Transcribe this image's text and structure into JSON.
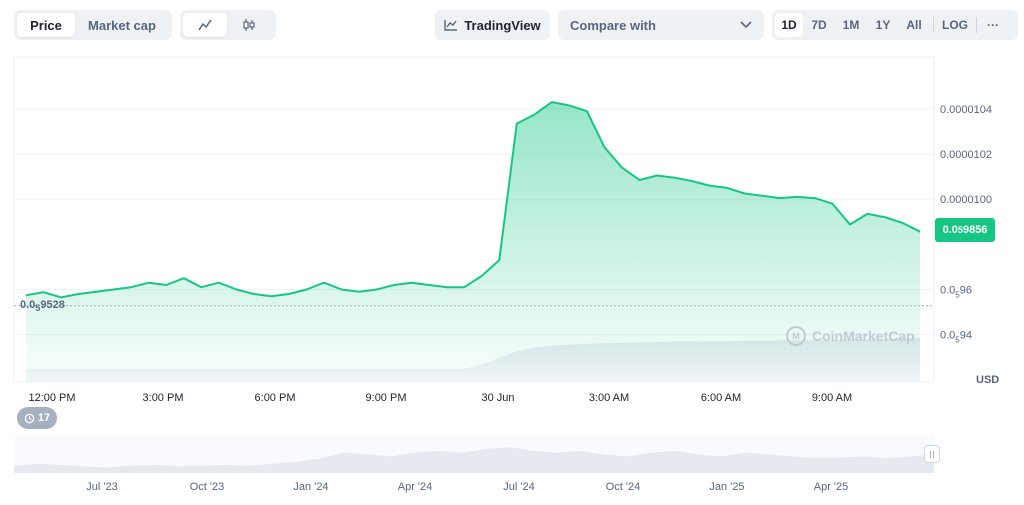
{
  "toolbar": {
    "view_tabs": [
      "Price",
      "Market cap"
    ],
    "active_view": "Price",
    "chart_types": [
      "line-chart-icon",
      "candlestick-icon"
    ],
    "tradingview_label": "TradingView",
    "compare_placeholder": "Compare with",
    "ranges": [
      "1D",
      "7D",
      "1M",
      "1Y",
      "All"
    ],
    "active_range": "1D",
    "log_label": "LOG",
    "more_label": "···"
  },
  "current_price": {
    "prefix": "0.0",
    "sub": "5",
    "digits": "9856"
  },
  "low_price": {
    "prefix": "0.0",
    "sub": "5",
    "digits": "9528"
  },
  "currency": "USD",
  "watermark": "CoinMarketCap",
  "events_count": "17",
  "colors": {
    "line": "#16c784",
    "fill_top": "#16c784",
    "navigator": "#e6eaf0",
    "grid": "#eff2f5"
  },
  "chart_data": {
    "type": "area",
    "x_tick_labels": [
      "12:00 PM",
      "3:00 PM",
      "6:00 PM",
      "9:00 PM",
      "30 Jun",
      "3:00 AM",
      "6:00 AM",
      "9:00 AM"
    ],
    "x": [
      "11:00 AM",
      "11:30 AM",
      "12:00 PM",
      "12:30 PM",
      "1:00 PM",
      "1:30 PM",
      "2:00 PM",
      "2:30 PM",
      "3:00 PM",
      "3:30 PM",
      "4:00 PM",
      "4:30 PM",
      "5:00 PM",
      "5:30 PM",
      "6:00 PM",
      "6:30 PM",
      "7:00 PM",
      "7:30 PM",
      "8:00 PM",
      "8:30 PM",
      "9:00 PM",
      "9:30 PM",
      "10:00 PM",
      "10:30 PM",
      "11:00 PM",
      "11:30 PM",
      "11:45 PM",
      "12:00 AM",
      "12:30 AM",
      "1:00 AM",
      "1:30 AM",
      "2:00 AM",
      "2:30 AM",
      "3:00 AM",
      "3:30 AM",
      "4:00 AM",
      "4:30 AM",
      "5:00 AM",
      "5:30 AM",
      "6:00 AM",
      "6:30 AM",
      "7:00 AM",
      "7:30 AM",
      "8:00 AM",
      "8:15 AM",
      "8:30 AM",
      "8:45 AM",
      "9:00 AM",
      "9:30 AM",
      "10:00 AM",
      "10:30 AM",
      "11:00 AM"
    ],
    "values": [
      9.574e-07,
      9.588e-07,
      9.565e-07,
      9.58e-07,
      9.59e-07,
      9.6e-07,
      9.61e-07,
      9.63e-07,
      9.62e-07,
      9.65e-07,
      9.61e-07,
      9.63e-07,
      9.6e-07,
      9.58e-07,
      9.57e-07,
      9.58e-07,
      9.6e-07,
      9.63e-07,
      9.6e-07,
      9.59e-07,
      9.6e-07,
      9.62e-07,
      9.63e-07,
      9.62e-07,
      9.61e-07,
      9.61e-07,
      9.66e-07,
      9.73e-07,
      1.0335e-06,
      1.0375e-06,
      1.043e-06,
      1.0415e-06,
      1.039e-06,
      1.023e-06,
      1.014e-06,
      1.0085e-06,
      1.0105e-06,
      1.0095e-06,
      1.008e-06,
      1.006e-06,
      1.005e-06,
      1.0025e-06,
      1.0015e-06,
      1.0005e-06,
      1.001e-06,
      1.0005e-06,
      9.98e-07,
      9.888e-07,
      9.935e-07,
      9.92e-07,
      9.895e-07,
      9.856e-07
    ],
    "volume": [
      0.3,
      0.3,
      0.3,
      0.3,
      0.3,
      0.3,
      0.3,
      0.3,
      0.3,
      0.3,
      0.3,
      0.3,
      0.3,
      0.3,
      0.3,
      0.3,
      0.3,
      0.3,
      0.3,
      0.3,
      0.3,
      0.3,
      0.3,
      0.3,
      0.3,
      0.3,
      0.4,
      0.55,
      0.7,
      0.78,
      0.82,
      0.85,
      0.87,
      0.88,
      0.89,
      0.9,
      0.91,
      0.92,
      0.92,
      0.93,
      0.93,
      0.94,
      0.94,
      0.95,
      0.95,
      0.95,
      0.95,
      0.96,
      0.97,
      0.98,
      0.99,
      1.0
    ],
    "y_tick_labels": [
      {
        "value": 1.04e-06,
        "label": "0.0000104"
      },
      {
        "value": 1.02e-06,
        "label": "0.0000102"
      },
      {
        "value": 1e-06,
        "label": "0.0000100"
      },
      {
        "value": 9.6e-07,
        "prefix": "0.0",
        "sub": "5",
        "digits": "96"
      },
      {
        "value": 9.4e-07,
        "prefix": "0.0",
        "sub": "5",
        "digits": "94"
      }
    ],
    "ylim": [
      9.19e-07,
      1.063e-06
    ],
    "reference_line": 9.528e-07,
    "navigator_labels": [
      "Jul '23",
      "Oct '23",
      "Jan '24",
      "Apr '24",
      "Jul '24",
      "Oct '24",
      "Jan '25",
      "Apr '25"
    ],
    "navigator_values": [
      0.2,
      0.25,
      0.22,
      0.18,
      0.15,
      0.2,
      0.22,
      0.18,
      0.2,
      0.22,
      0.2,
      0.25,
      0.3,
      0.4,
      0.55,
      0.5,
      0.45,
      0.55,
      0.6,
      0.55,
      0.65,
      0.7,
      0.6,
      0.55,
      0.6,
      0.5,
      0.45,
      0.55,
      0.6,
      0.5,
      0.45,
      0.55,
      0.5,
      0.45,
      0.4,
      0.42,
      0.45,
      0.4,
      0.45,
      0.5
    ],
    "grid": true,
    "legend": "none"
  }
}
